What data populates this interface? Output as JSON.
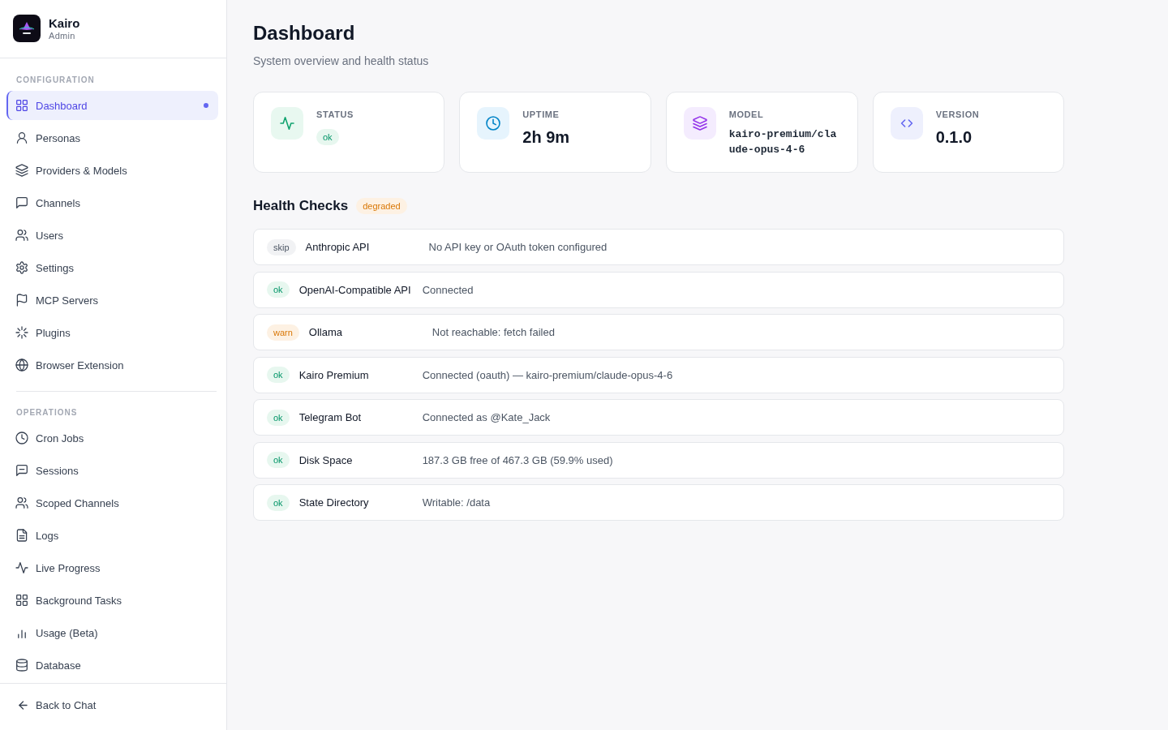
{
  "sidebar": {
    "brand": {
      "name": "Kairo",
      "subtitle": "Admin"
    },
    "sections": [
      {
        "title": "CONFIGURATION",
        "items": [
          {
            "label": "Dashboard",
            "selected": true
          },
          {
            "label": "Personas",
            "selected": false
          },
          {
            "label": "Providers & Models",
            "selected": false
          },
          {
            "label": "Channels",
            "selected": false
          },
          {
            "label": "Users",
            "selected": false
          },
          {
            "label": "Settings",
            "selected": false
          },
          {
            "label": "MCP Servers",
            "selected": false
          },
          {
            "label": "Plugins",
            "selected": false
          },
          {
            "label": "Browser Extension",
            "selected": false
          }
        ]
      },
      {
        "title": "OPERATIONS",
        "items": [
          {
            "label": "Cron Jobs",
            "selected": false
          },
          {
            "label": "Sessions",
            "selected": false
          },
          {
            "label": "Scoped Channels",
            "selected": false
          },
          {
            "label": "Logs",
            "selected": false
          },
          {
            "label": "Live Progress",
            "selected": false
          },
          {
            "label": "Background Tasks",
            "selected": false
          },
          {
            "label": "Usage (Beta)",
            "selected": false
          },
          {
            "label": "Database",
            "selected": false
          }
        ]
      }
    ],
    "footer_link": "Back to Chat"
  },
  "main": {
    "title": "Dashboard",
    "subtitle": "System overview and health status",
    "stat_cards": [
      {
        "kind": "status",
        "label": "STATUS",
        "badge": {
          "kind": "ok",
          "label": "ok"
        }
      },
      {
        "kind": "uptime",
        "label": "UPTIME",
        "value": "2h 9m"
      },
      {
        "kind": "model",
        "label": "MODEL",
        "value": "kairo-premium/claude-opus-4-6"
      },
      {
        "kind": "version",
        "label": "VERSION",
        "value": "0.1.0"
      }
    ],
    "health_checks": {
      "title": "Health Checks",
      "badge": {
        "kind": "warn",
        "label": "degraded"
      },
      "rows": [
        {
          "kind": "skip",
          "status": "skip",
          "name": "Anthropic API",
          "detail": "No API key or OAuth token configured"
        },
        {
          "kind": "ok",
          "status": "ok",
          "name": "OpenAI-Compatible API",
          "detail": "Connected"
        },
        {
          "kind": "warn",
          "status": "warn",
          "name": "Ollama",
          "detail": "Not reachable: fetch failed"
        },
        {
          "kind": "ok",
          "status": "ok",
          "name": "Kairo Premium",
          "detail": "Connected (oauth) — kairo-premium/claude-opus-4-6"
        },
        {
          "kind": "ok",
          "status": "ok",
          "name": "Telegram Bot",
          "detail": "Connected as @Kate_Jack"
        },
        {
          "kind": "ok",
          "status": "ok",
          "name": "Disk Space",
          "detail": "187.3 GB free of 467.3 GB (59.9% used)"
        },
        {
          "kind": "ok",
          "status": "ok",
          "name": "State Directory",
          "detail": "Writable: /data"
        }
      ]
    }
  }
}
